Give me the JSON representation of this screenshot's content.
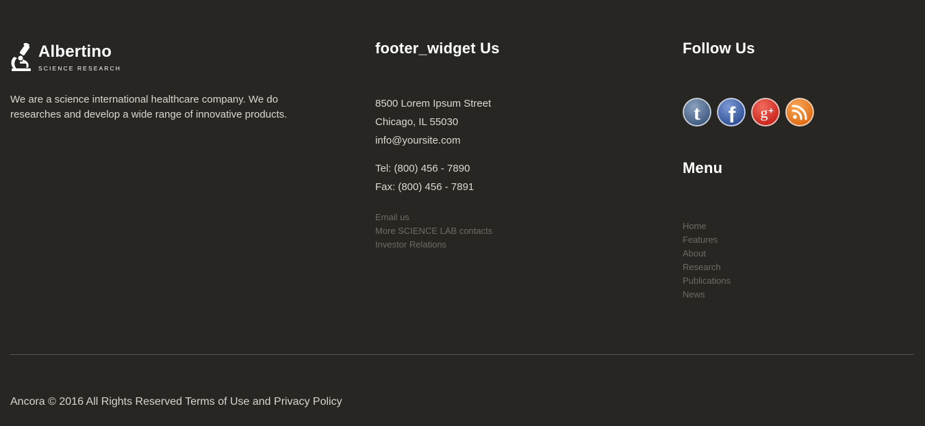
{
  "brand": {
    "name": "Albertino",
    "tagline": "SCIENCE RESEARCH",
    "about": "We are a science international healthcare company. We do researches and develop a wide range of innovative products."
  },
  "contact_widget": {
    "title": "footer_widget Us",
    "address": [
      "8500 Lorem Ipsum Street",
      "Chicago, IL 55030",
      "info@yoursite.com"
    ],
    "phones": [
      "Tel: (800) 456 - 7890",
      "Fax: (800) 456 - 7891"
    ],
    "links": [
      "Email us",
      "More SCIENCE LAB contacts",
      "Investor Relations"
    ]
  },
  "follow": {
    "title": "Follow Us",
    "icons": [
      "tumblr-icon",
      "facebook-icon",
      "google-plus-icon",
      "rss-icon"
    ],
    "colors": {
      "tumblr": "#3f5a80",
      "facebook": "#3b5998",
      "google_plus": "#dd2f24",
      "rss": "#f07a1c"
    }
  },
  "menu": {
    "title": "Menu",
    "items": [
      "Home",
      "Features",
      "About",
      "Research",
      "Publications",
      "News"
    ]
  },
  "footer": {
    "prefix": "Ancora © 2016 All Rights Reserved ",
    "terms": "Terms of Use",
    "and": " and ",
    "privacy": "Privacy Policy"
  },
  "colors": {
    "background": "#282623",
    "link_muted": "#6e6b66",
    "text": "#dcd9d4"
  }
}
